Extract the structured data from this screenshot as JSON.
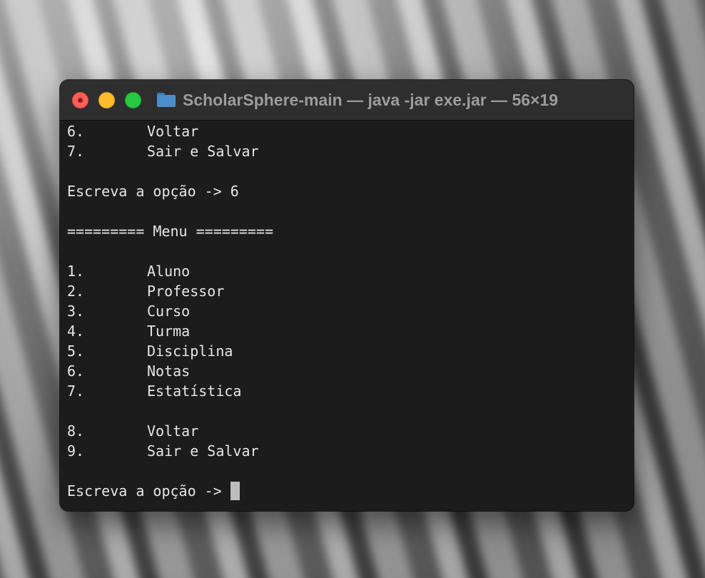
{
  "window": {
    "title": "ScholarSphere-main — java -jar exe.jar — 56×19"
  },
  "colors": {
    "terminal_bg": "#1c1c1c",
    "titlebar_bg": "#2e2e2e",
    "text": "#e6e6e6",
    "close": "#ff5f57",
    "minimize": "#febc2e",
    "zoom": "#28c840",
    "folder": "#4a8fcc"
  },
  "icons": {
    "title": "folder-icon"
  },
  "terminal": {
    "prev_menu": [
      {
        "num": "6.",
        "label": "Voltar"
      },
      {
        "num": "7.",
        "label": "Sair e Salvar"
      }
    ],
    "prev_prompt": "Escreva a opção -> 6",
    "menu_header": "========= Menu =========",
    "menu_items": [
      {
        "num": "1.",
        "label": "Aluno"
      },
      {
        "num": "2.",
        "label": "Professor"
      },
      {
        "num": "3.",
        "label": "Curso"
      },
      {
        "num": "4.",
        "label": "Turma"
      },
      {
        "num": "5.",
        "label": "Disciplina"
      },
      {
        "num": "6.",
        "label": "Notas"
      },
      {
        "num": "7.",
        "label": "Estatística"
      }
    ],
    "menu_footer_items": [
      {
        "num": "8.",
        "label": "Voltar"
      },
      {
        "num": "9.",
        "label": "Sair e Salvar"
      }
    ],
    "current_prompt": "Escreva a opção ->"
  }
}
